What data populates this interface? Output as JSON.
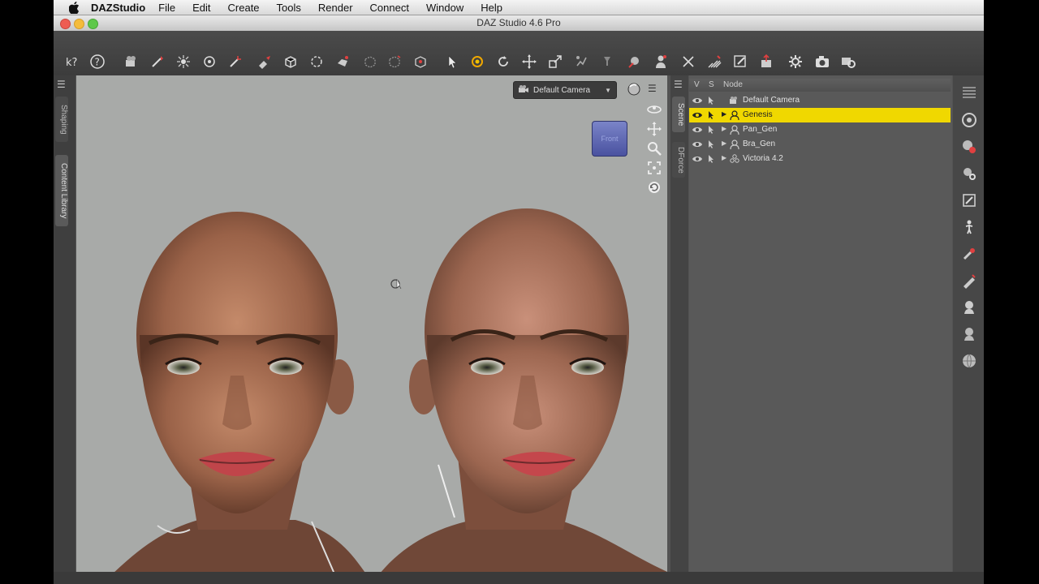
{
  "menubar": {
    "app_name": "DAZStudio",
    "items": [
      "File",
      "Edit",
      "Create",
      "Tools",
      "Render",
      "Connect",
      "Window",
      "Help"
    ]
  },
  "window": {
    "title": "DAZ Studio 4.6 Pro"
  },
  "left_dock": {
    "tabs": [
      "Shaping",
      "Content Library"
    ]
  },
  "viewport": {
    "camera_menu": "Default Camera",
    "viewcube_label": "Front"
  },
  "scene": {
    "tab_labels": [
      "Scene",
      "DForce"
    ],
    "columns": {
      "visible": "V",
      "selectable": "S",
      "node": "Node"
    },
    "nodes": [
      {
        "label": "Default Camera",
        "icon": "camera-icon",
        "selected": false,
        "has_children": false
      },
      {
        "label": "Genesis",
        "icon": "figure-icon",
        "selected": true,
        "has_children": true
      },
      {
        "label": "Pan_Gen",
        "icon": "figure-icon",
        "selected": false,
        "has_children": true
      },
      {
        "label": "Bra_Gen",
        "icon": "figure-icon",
        "selected": false,
        "has_children": true
      },
      {
        "label": "Victoria 4.2",
        "icon": "group-icon",
        "selected": false,
        "has_children": true
      }
    ]
  },
  "colors": {
    "selection": "#f0d800",
    "viewport_bg": "#a8aaa8",
    "panel_bg": "#595959"
  }
}
